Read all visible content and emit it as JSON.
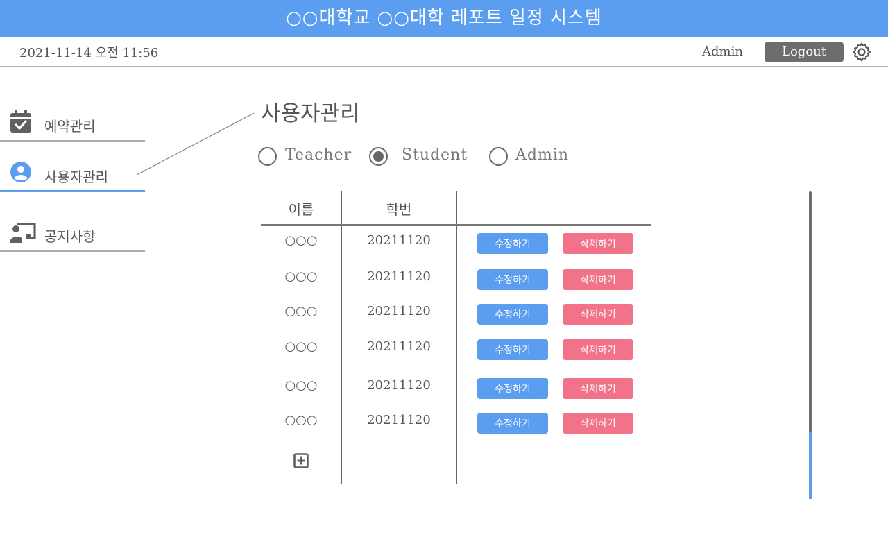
{
  "app": {
    "title": "○○대학교 ○○대학 레포트 일정 시스템"
  },
  "topbar": {
    "datetime": "2021-11-14 오전 11:56",
    "user": "Admin",
    "logout_label": "Logout",
    "settings_icon": "gear-icon"
  },
  "sidebar": {
    "items": [
      {
        "label": "예약관리",
        "icon": "calendar-check-icon",
        "active": false
      },
      {
        "label": "사용자관리",
        "icon": "user-circle-icon",
        "active": true
      },
      {
        "label": "공지사항",
        "icon": "presentation-icon",
        "active": false
      }
    ]
  },
  "main": {
    "title": "사용자관리",
    "roles": [
      {
        "label": "Teacher",
        "selected": false
      },
      {
        "label": "Student",
        "selected": true
      },
      {
        "label": "Admin",
        "selected": false
      }
    ],
    "table": {
      "columns": [
        "이름",
        "학번"
      ],
      "rows": [
        {
          "name": "○○○",
          "id": "20211120"
        },
        {
          "name": "○○○",
          "id": "20211120"
        },
        {
          "name": "○○○",
          "id": "20211120"
        },
        {
          "name": "○○○",
          "id": "20211120"
        },
        {
          "name": "○○○",
          "id": "20211120"
        },
        {
          "name": "○○○",
          "id": "20211120"
        }
      ],
      "edit_label": "수정하기",
      "delete_label": "삭제하기",
      "add_icon": "plus-square-icon"
    },
    "scroll": {
      "position_fraction": 0.78
    }
  },
  "colors": {
    "accent": "#5b9ef0",
    "danger": "#f2728a",
    "dark": "#6d6d6d"
  }
}
